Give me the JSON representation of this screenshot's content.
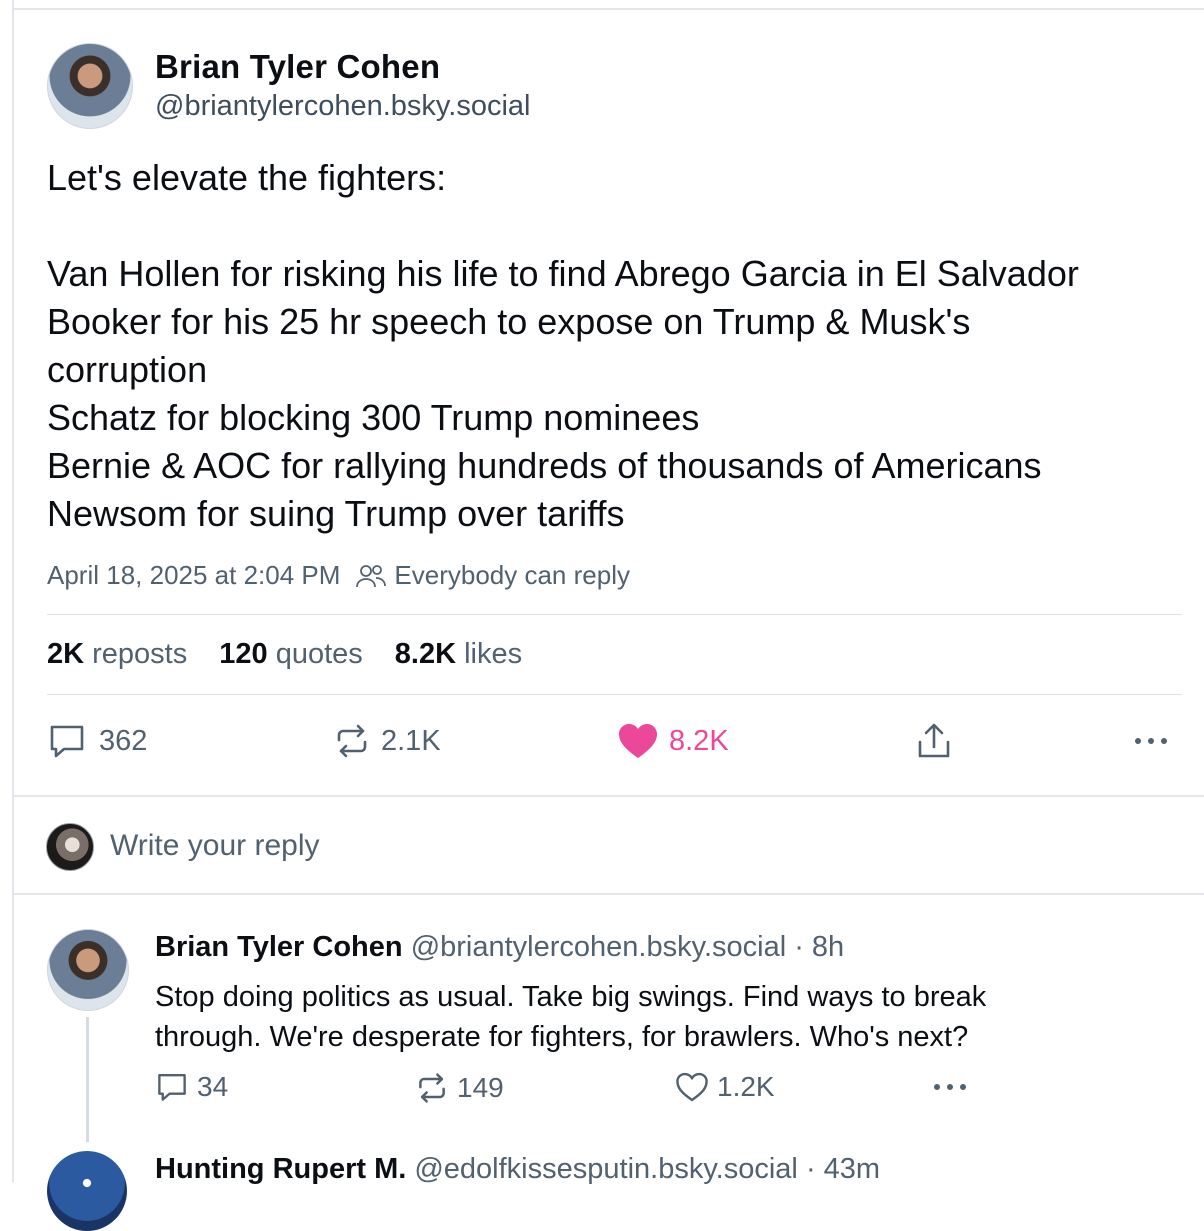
{
  "post": {
    "author": {
      "name": "Brian Tyler Cohen",
      "handle": "@briantylercohen.bsky.social"
    },
    "text_lines": [
      "Let's elevate the fighters:",
      "",
      "Van Hollen for risking his life to find Abrego Garcia in El Salvador",
      "Booker for his 25 hr speech to expose on Trump & Musk's",
      "corruption",
      "Schatz for blocking 300 Trump nominees",
      "Bernie & AOC for rallying hundreds of thousands of Americans",
      "Newsom for suing Trump over tariffs"
    ],
    "timestamp": "April 18, 2025 at 2:04 PM",
    "reply_setting": "Everybody can reply",
    "stats": {
      "reposts_count": "2K",
      "reposts_label": "reposts",
      "quotes_count": "120",
      "quotes_label": "quotes",
      "likes_count": "8.2K",
      "likes_label": "likes"
    },
    "actions": {
      "replies": "362",
      "reposts": "2.1K",
      "likes": "8.2K",
      "liked": true,
      "like_color": "#ec4899"
    }
  },
  "reply_composer": {
    "placeholder": "Write your reply"
  },
  "replies": [
    {
      "author_name": "Brian Tyler Cohen",
      "handle": "@briantylercohen.bsky.social",
      "time": "· 8h",
      "text_lines": [
        "Stop doing politics as usual. Take big swings. Find ways to break",
        "through. We're desperate for fighters, for brawlers. Who's next?"
      ],
      "replies": "34",
      "reposts": "149",
      "likes": "1.2K"
    },
    {
      "author_name": "Hunting Rupert M.",
      "handle": "@edolfkissesputin.bsky.social",
      "time": "· 43m"
    }
  ]
}
